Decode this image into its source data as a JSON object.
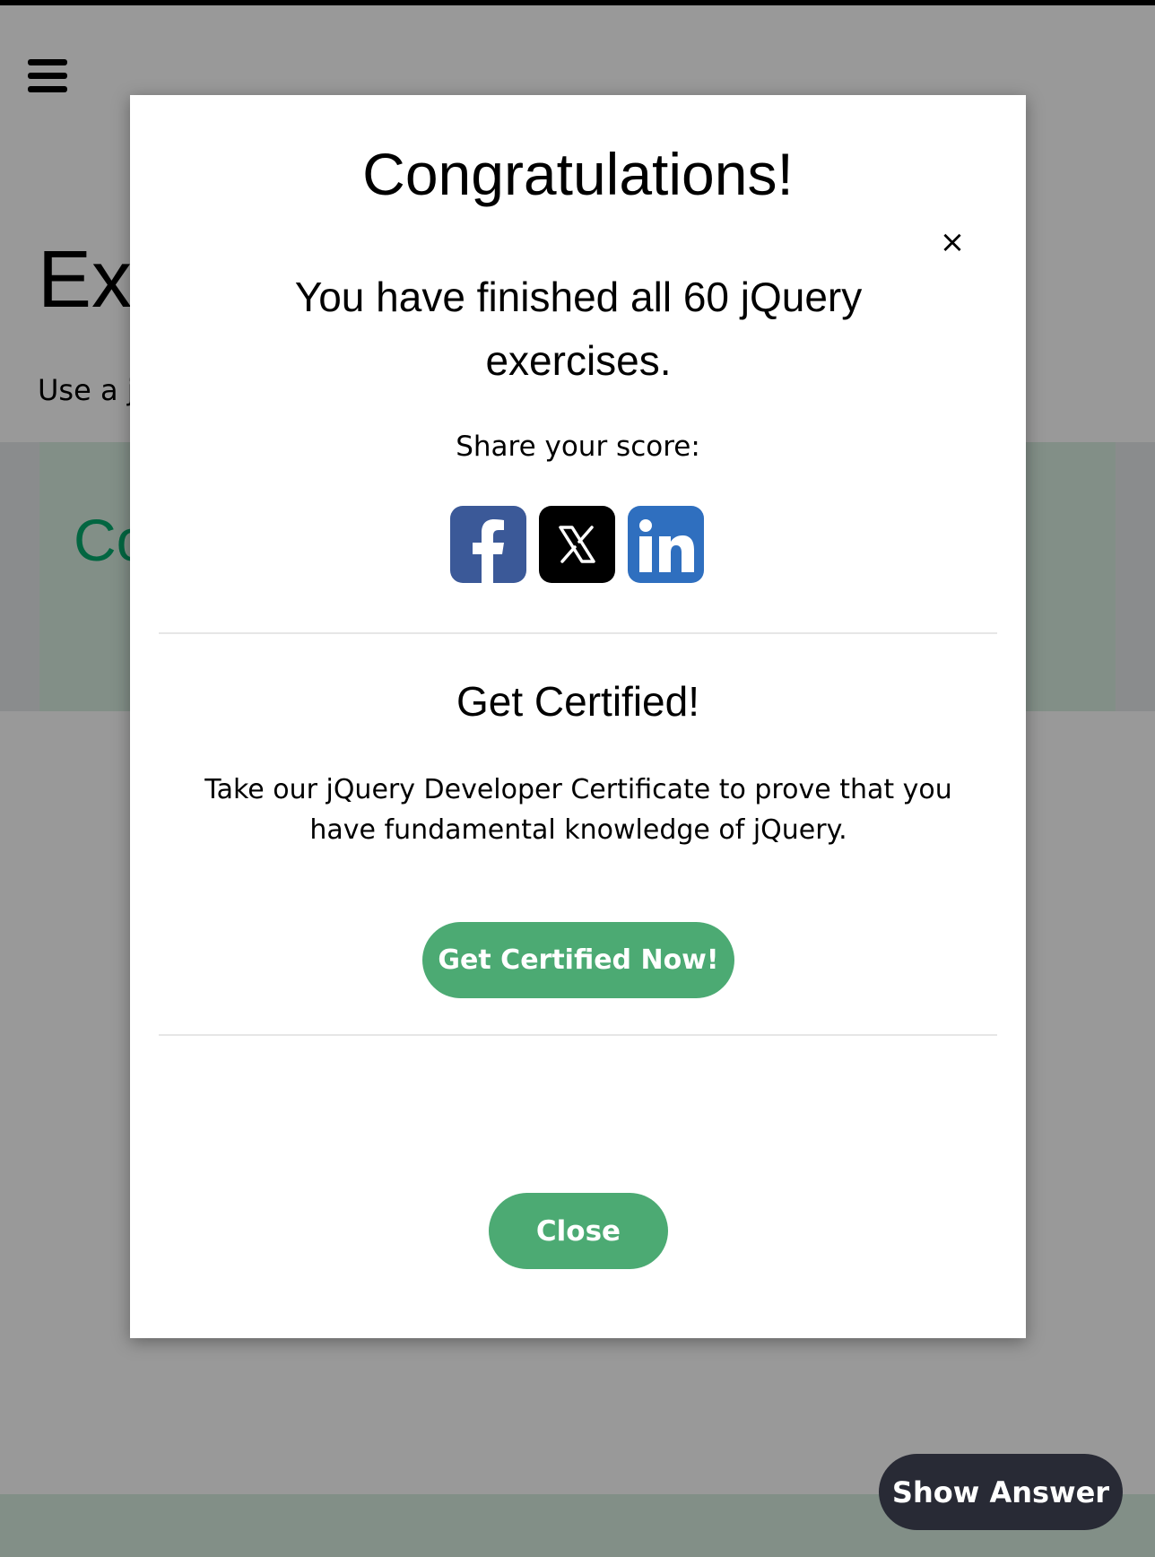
{
  "page": {
    "heading": "Exercise:",
    "instruction": "Use a jQuery",
    "code_preview": "Co"
  },
  "icons": {
    "menu": "hamburger-menu-icon",
    "close": "close-x-icon",
    "share": [
      "facebook-icon",
      "x-twitter-icon",
      "linkedin-icon"
    ]
  },
  "modal": {
    "close_symbol": "×",
    "title": "Congratulations!",
    "message": "You have finished all 60 jQuery exercises.",
    "share_label": "Share your score:",
    "certificate": {
      "title": "Get Certified!",
      "text": "Take our jQuery Developer Certificate to prove that you have fundamental knowledge of jQuery.",
      "button": "Get Certified Now!"
    },
    "close_button": "Close"
  },
  "show_answer_button": "Show Answer",
  "colors": {
    "accent_green": "#4caa73",
    "dark_button": "#282a35",
    "facebook": "#3b5998",
    "linkedin": "#2f6fbf",
    "x": "#000000"
  }
}
